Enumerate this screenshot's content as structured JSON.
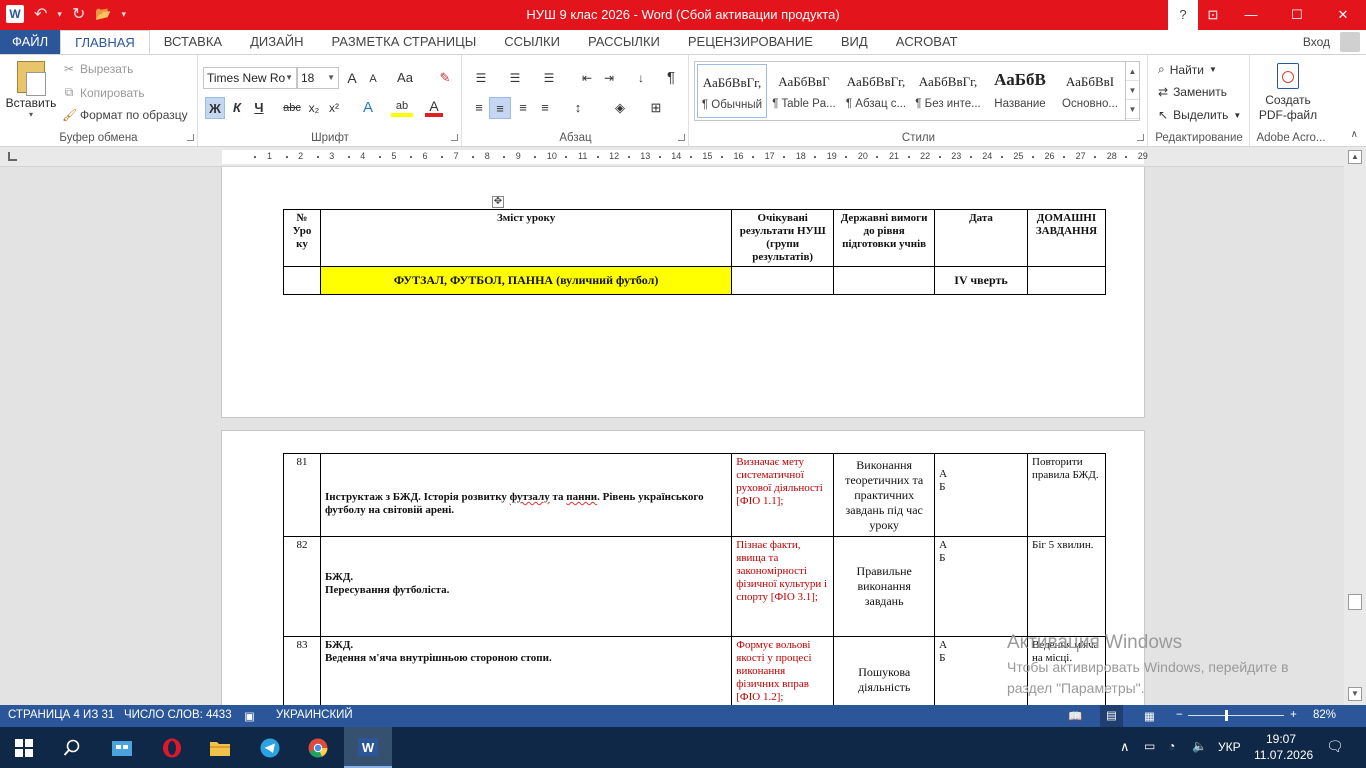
{
  "window": {
    "title": "НУШ 9 клас 2026 -  Word (Сбой активации продукта)",
    "help": "?",
    "ribbon_display": "⊡",
    "minimize": "—",
    "maximize": "☐",
    "close": "✕"
  },
  "qat": {
    "word_logo": "W",
    "undo": "↶",
    "undo_dd": "▾",
    "redo": "↻",
    "open": "📂",
    "customize": "▾"
  },
  "tabs": [
    "ФАЙЛ",
    "ГЛАВНАЯ",
    "ВСТАВКА",
    "ДИЗАЙН",
    "РАЗМЕТКА СТРАНИЦЫ",
    "ССЫЛКИ",
    "РАССЫЛКИ",
    "РЕЦЕНЗИРОВАНИЕ",
    "ВИД",
    "ACROBAT"
  ],
  "login": "Вход",
  "ribbon": {
    "clipboard": {
      "label": "Буфер обмена",
      "paste": "Вставить",
      "paste_dd": "▾",
      "cut": "Вырезать",
      "copy": "Копировать",
      "format_painter": "Формат по образцу"
    },
    "font": {
      "label": "Шрифт",
      "font_name": "Times New Ro",
      "font_size": "18",
      "grow": "A",
      "shrink": "A",
      "case": "Aa",
      "clear": "✎",
      "bold": "Ж",
      "italic": "К",
      "underline": "Ч",
      "strike": "abc",
      "subscript": "x₂",
      "superscript": "x²",
      "effects": "A",
      "highlight": "ab",
      "color": "A"
    },
    "paragraph": {
      "label": "Абзац",
      "pilcrow": "¶"
    },
    "styles": {
      "label": "Стили",
      "items": [
        {
          "preview": "АаБбВвГг,",
          "name": "¶ Обычный"
        },
        {
          "preview": "АаБбВвГ",
          "name": "¶ Table Pa..."
        },
        {
          "preview": "АаБбВвГг,",
          "name": "¶ Абзац с..."
        },
        {
          "preview": "АаБбВвГг,",
          "name": "¶ Без инте..."
        },
        {
          "preview": "АаБбВ",
          "name": "Название"
        },
        {
          "preview": "АаБбВвІ",
          "name": "Основно..."
        }
      ]
    },
    "editing": {
      "label": "Редактирование",
      "find": "Найти",
      "replace": "Заменить",
      "select": "Выделить"
    },
    "acrobat": {
      "label": "Adobe Acro...",
      "create_pdf_line1": "Создать",
      "create_pdf_line2": "PDF-файл"
    }
  },
  "ruler": [
    "1",
    "2",
    "3",
    "4",
    "5",
    "6",
    "7",
    "8",
    "9",
    "10",
    "11",
    "12",
    "13",
    "14",
    "15",
    "16",
    "17",
    "18",
    "19",
    "20",
    "21",
    "22",
    "23",
    "24",
    "25",
    "26",
    "27",
    "28",
    "29"
  ],
  "page1": {
    "move_handle": "✥",
    "headers": {
      "num": "№ Уро ку",
      "content": "Зміст уроку",
      "expected": "Очікувані результати НУШ (групи результатів)",
      "state": "Державні вимоги до рівня підготовки учнів",
      "date": "Дата",
      "homework": "ДОМАШНІ ЗАВДАННЯ"
    },
    "section_title": "ФУТЗАЛ, ФУТБОЛ, ПАННА (вуличний футбол)",
    "quarter": "IV чверть"
  },
  "page2": {
    "rows": [
      {
        "num": "81",
        "content_a": "Інструктаж з БЖД. Історія розвитку ",
        "content_b": "футзалу",
        "content_c": " та ",
        "content_d": "панни",
        "content_e": ". Рівень українського футболу на світовій арені.",
        "expected": "Визначає мету систематичної рухової діяльності [ФІО 1.1];",
        "state": "Виконання теоретичних та практичних завдань під час уроку",
        "date_a": "А",
        "date_b": "Б",
        "homework": "Повторити правила БЖД."
      },
      {
        "num": "82",
        "content_title": "БЖД.",
        "content_text": "Пересування футболіста.",
        "expected": "Пізнає факти, явища та закономірності фізичної культури і спорту [ФІО 3.1];",
        "state": "Правильне виконання завдань",
        "date_a": "А",
        "date_b": "Б",
        "homework": "Біг 5 хвилин."
      },
      {
        "num": "83",
        "content_title": "БЖД.",
        "content_text": "Ведення м'яча внутрішньою стороною стопи.",
        "expected": "Формує вольові якості у процесі виконання фізичних вправ [ФІО 1.2];",
        "state": "Пошукова діяльність",
        "date_a": "А",
        "date_b": "Б",
        "homework": "Ведення м'яча на місці."
      }
    ]
  },
  "watermark": {
    "line1": "Активация Windows",
    "line2": "Чтобы активировать Windows, перейдите в",
    "line3": "раздел \"Параметры\"."
  },
  "statusbar": {
    "page": "СТРАНИЦА 4 ИЗ 31",
    "words": "ЧИСЛО СЛОВ: 4433",
    "language": "УКРАИНСКИЙ",
    "zoom_minus": "−",
    "zoom_plus": "+",
    "zoom": "82%"
  },
  "taskbar": {
    "lang": "УКР",
    "time": "19:07",
    "date": "11.07.2026"
  },
  "colors": {
    "titlebar": "#e3141b",
    "word_blue": "#2b579a",
    "highlight_yellow": "#ffff00",
    "red_text": "#c00000",
    "taskbar": "#0f2847"
  }
}
